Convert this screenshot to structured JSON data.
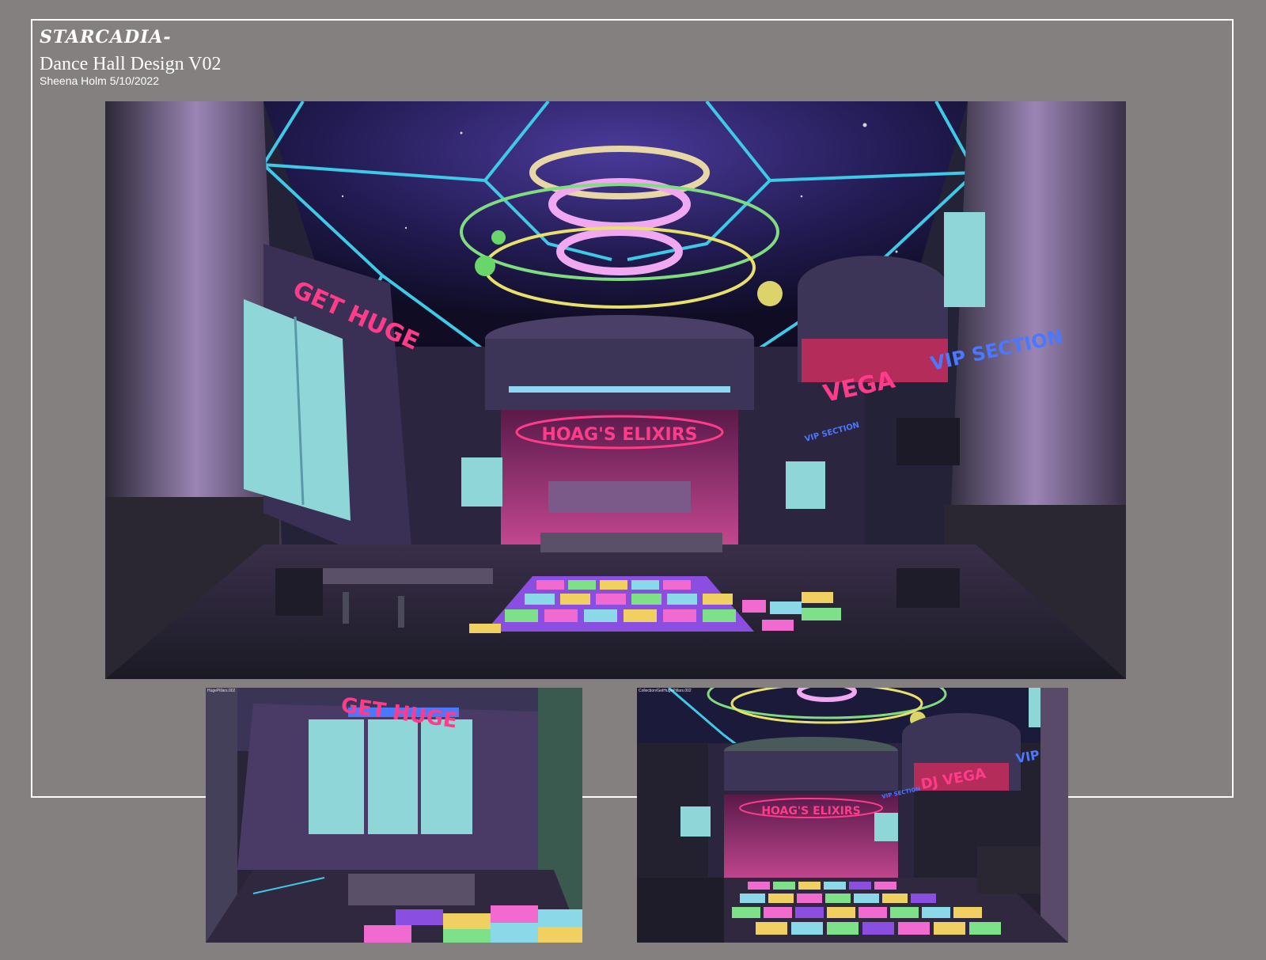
{
  "header": {
    "logo": "STARCADIA-",
    "title": "Dance Hall Design V02",
    "byline": "Sheena Holm 5/10/2022"
  },
  "main_render": {
    "sign_left": "GET HUGE",
    "sign_bar": "HOAG'S ELIXIRS",
    "sign_booth": "VEGA",
    "sign_vip": "VIP SECTION",
    "sign_small": "VIP SECTION"
  },
  "thumb_left": {
    "caption": "HugePillars.002",
    "sign": "GET HUGE"
  },
  "thumb_right": {
    "caption": "Collection/GetHugePillars.002",
    "sign_bar": "HOAG'S ELIXIRS",
    "sign_booth": "DJ VEGA",
    "sign_vip": "VIP SE",
    "sign_small": "VIP SECTION"
  },
  "colors": {
    "background": "#858080",
    "neon_pink": "#ff3c8a",
    "neon_cyan": "#3ec9e6",
    "screen_cyan": "#8fd6d8"
  }
}
